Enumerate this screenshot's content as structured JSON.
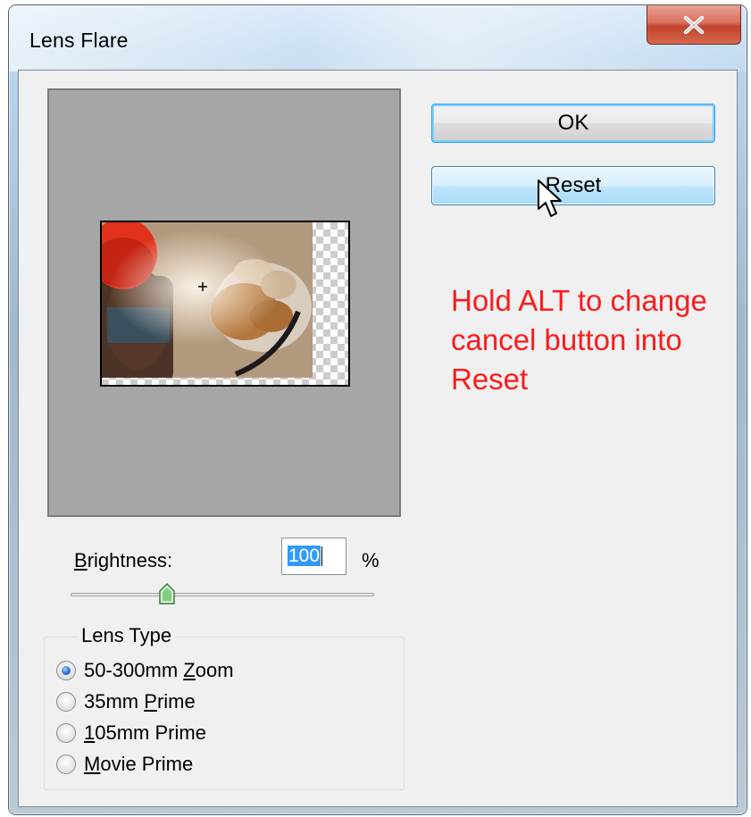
{
  "window": {
    "title": "Lens Flare",
    "close_icon": "close-x-icon"
  },
  "buttons": {
    "ok_label": "OK",
    "reset_label": "Reset"
  },
  "annotation": {
    "text": "Hold ALT to change\ncancel button into\nReset",
    "color": "#ff1a1a"
  },
  "brightness": {
    "label_pre": "",
    "label_mnemonic": "B",
    "label_post": "rightness:",
    "value": "100",
    "unit": "%"
  },
  "lens_type": {
    "legend": "Lens Type",
    "options": [
      {
        "pre": "50-300mm ",
        "mnemonic": "Z",
        "post": "oom",
        "checked": true
      },
      {
        "pre": "35mm ",
        "mnemonic": "P",
        "post": "rime",
        "checked": false
      },
      {
        "pre": "",
        "mnemonic": "1",
        "post": "05mm Prime",
        "checked": false
      },
      {
        "pre": "",
        "mnemonic": "M",
        "post": "ovie Prime",
        "checked": false
      }
    ]
  },
  "colors": {
    "accent": "#3399ff",
    "preview_bg": "#a6a6a6",
    "dialog_bg": "#f0f0f0"
  }
}
